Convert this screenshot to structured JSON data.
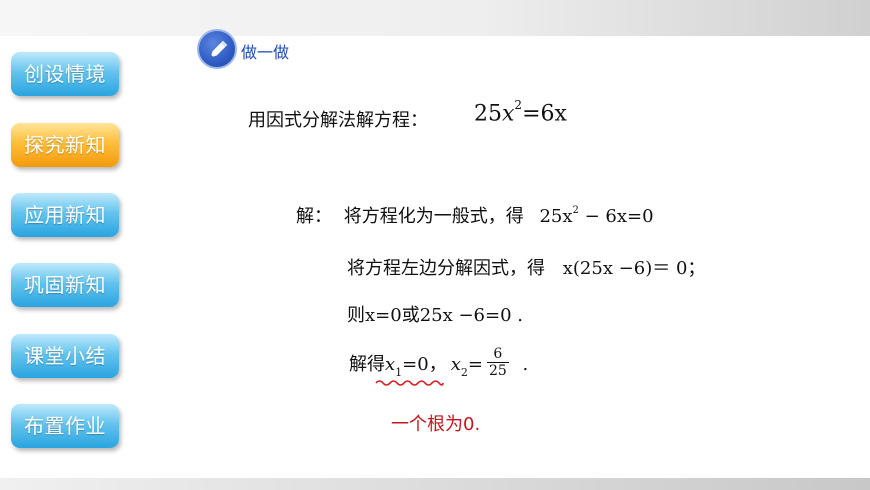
{
  "sidebar": {
    "items": [
      {
        "label": "创设情境",
        "active": false
      },
      {
        "label": "探究新知",
        "active": true
      },
      {
        "label": "应用新知",
        "active": false
      },
      {
        "label": "巩固新知",
        "active": false
      },
      {
        "label": "课堂小结",
        "active": false
      },
      {
        "label": "布置作业",
        "active": false
      }
    ]
  },
  "header": {
    "label": "做一做",
    "icon": "pencil-icon"
  },
  "problem": {
    "prompt": "用因式分解法解方程：",
    "coef": "25",
    "var": "x",
    "exp": "2",
    "rhs": "=6x"
  },
  "solution": {
    "step1": {
      "prefix": "解：",
      "text": "将方程化为一般式，得",
      "coef": "25x",
      "exp": "2",
      "rest": " − 6x=0"
    },
    "step2": {
      "text": "将方程左边分解因式，得",
      "math": "x(25x −6)＝ 0；"
    },
    "step3": {
      "prefix": "则",
      "math1": "x=0",
      "mid": "或",
      "math2": "25x −6=0 ."
    },
    "step4": {
      "prefix": "解得",
      "x1_var": "x",
      "x1_sub": "1",
      "x1_rest": "=0，",
      "x2_var": "x",
      "x2_sub": "2",
      "x2_eq": "=",
      "frac_num": "6",
      "frac_den": "25",
      "tail": " ."
    }
  },
  "annotation": {
    "text": "一个根为0.",
    "color": "#c4161c"
  },
  "colors": {
    "side_blue": "#2aa4e0",
    "side_active": "#f39a0c",
    "header_blue": "#1d4fb8"
  }
}
